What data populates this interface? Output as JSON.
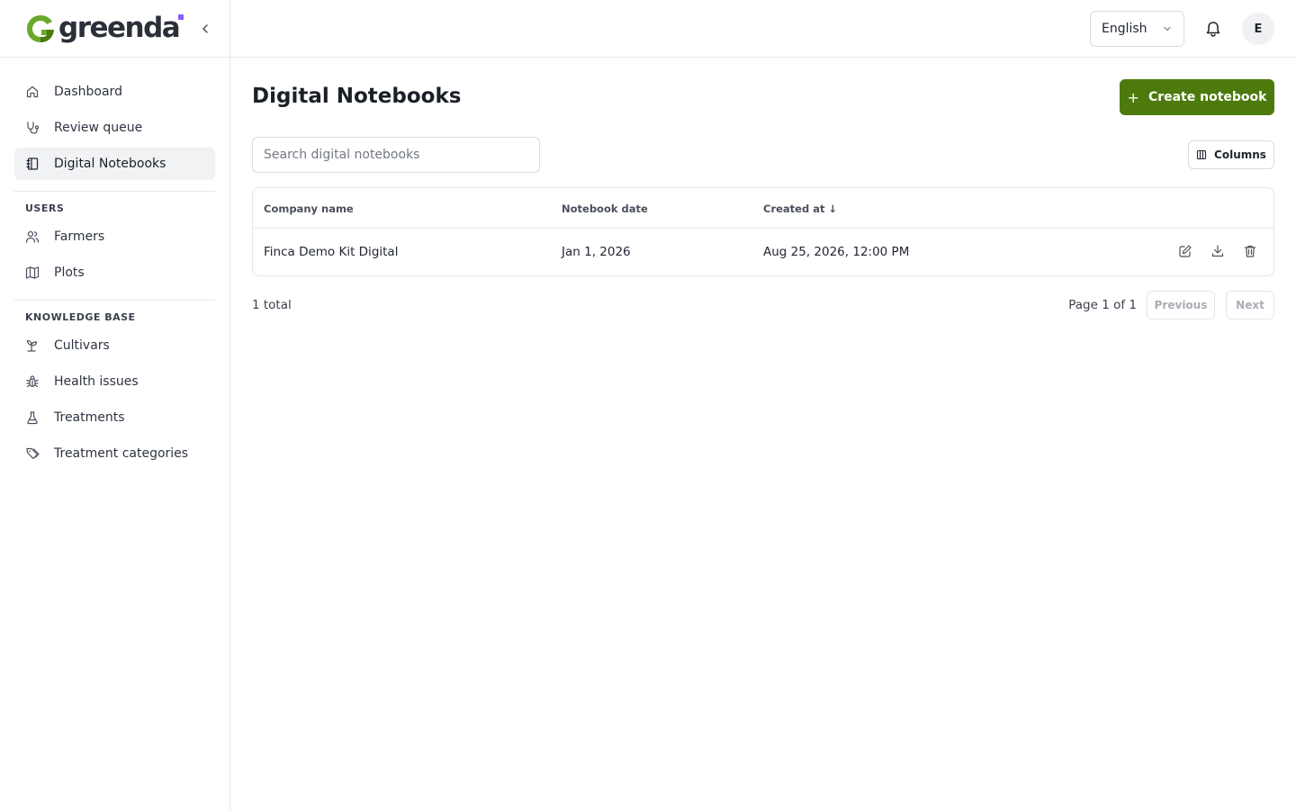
{
  "brand": {
    "name": "greenda",
    "accent": "#4d7a0c",
    "dot_color": "#8b5cf6"
  },
  "sidebar": {
    "main_items": [
      {
        "label": "Dashboard",
        "icon": "home-icon"
      },
      {
        "label": "Review queue",
        "icon": "stethoscope-icon"
      },
      {
        "label": "Digital Notebooks",
        "icon": "notebook-icon",
        "active": true
      }
    ],
    "users_section": {
      "title": "USERS",
      "items": [
        {
          "label": "Farmers",
          "icon": "users-icon"
        },
        {
          "label": "Plots",
          "icon": "map-icon"
        }
      ]
    },
    "kb_section": {
      "title": "KNOWLEDGE BASE",
      "items": [
        {
          "label": "Cultivars",
          "icon": "sprout-icon"
        },
        {
          "label": "Health issues",
          "icon": "bug-icon"
        },
        {
          "label": "Treatments",
          "icon": "flask-icon"
        },
        {
          "label": "Treatment categories",
          "icon": "tags-icon"
        }
      ]
    }
  },
  "header": {
    "language": "English",
    "avatar_initial": "E"
  },
  "main": {
    "title": "Digital Notebooks",
    "create_label": "Create notebook",
    "search_placeholder": "Search digital notebooks",
    "columns_label": "Columns",
    "table": {
      "headers": [
        "Company name",
        "Notebook date",
        "Created at"
      ],
      "sort_indicator": "↓",
      "rows": [
        {
          "company": "Finca Demo Kit Digital",
          "notebook_date": "Jan 1, 2026",
          "created_at": "Aug 25, 2026, 12:00 PM"
        }
      ]
    },
    "total": "1 total",
    "page_info": "Page 1 of 1",
    "prev_label": "Previous",
    "next_label": "Next"
  }
}
